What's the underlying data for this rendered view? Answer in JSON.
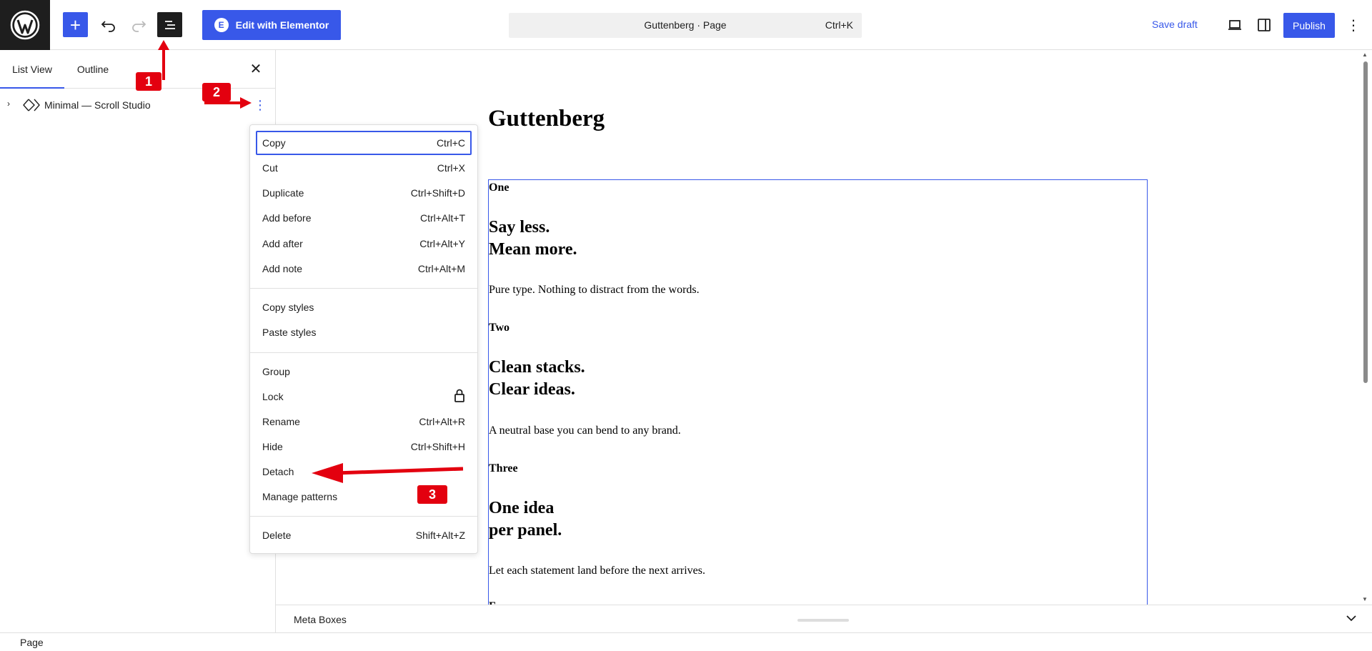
{
  "topbar": {
    "elementor_label": "Edit with Elementor",
    "elementor_icon_glyph": "E",
    "command_title": "Guttenberg · Page",
    "command_shortcut": "Ctrl+K",
    "save_draft_label": "Save draft",
    "publish_label": "Publish",
    "add_glyph": "+",
    "options_glyph": "⋮"
  },
  "sidebar": {
    "tabs": [
      {
        "label": "List View",
        "active": true
      },
      {
        "label": "Outline",
        "active": false
      }
    ],
    "close_glyph": "✕",
    "tree": [
      {
        "label": "Minimal — Scroll Studio",
        "chevron": "›",
        "menu_glyph": "⋮"
      }
    ]
  },
  "canvas": {
    "title": "Guttenberg",
    "sections": [
      {
        "label": "One",
        "headline_1": "Say less.",
        "headline_2": "Mean more.",
        "body": "Pure type. Nothing to distract from the words."
      },
      {
        "label": "Two",
        "headline_1": "Clean stacks.",
        "headline_2": "Clear ideas.",
        "body": "A neutral base you can bend to any brand."
      },
      {
        "label": "Three",
        "headline_1": "One idea",
        "headline_2": "per panel.",
        "body": "Let each statement land before the next arrives."
      },
      {
        "label": "F"
      }
    ]
  },
  "dropdown": {
    "groups": [
      [
        {
          "label": "Copy",
          "shortcut": "Ctrl+C",
          "focused": true
        },
        {
          "label": "Cut",
          "shortcut": "Ctrl+X"
        },
        {
          "label": "Duplicate",
          "shortcut": "Ctrl+Shift+D"
        },
        {
          "label": "Add before",
          "shortcut": "Ctrl+Alt+T"
        },
        {
          "label": "Add after",
          "shortcut": "Ctrl+Alt+Y"
        },
        {
          "label": "Add note",
          "shortcut": "Ctrl+Alt+M"
        }
      ],
      [
        {
          "label": "Copy styles",
          "shortcut": ""
        },
        {
          "label": "Paste styles",
          "shortcut": ""
        }
      ],
      [
        {
          "label": "Group",
          "shortcut": ""
        },
        {
          "label": "Lock",
          "shortcut": "",
          "icon": "lock-icon"
        },
        {
          "label": "Rename",
          "shortcut": "Ctrl+Alt+R"
        },
        {
          "label": "Hide",
          "shortcut": "Ctrl+Shift+H"
        },
        {
          "label": "Detach",
          "shortcut": ""
        },
        {
          "label": "Manage patterns",
          "shortcut": ""
        }
      ],
      [
        {
          "label": "Delete",
          "shortcut": "Shift+Alt+Z"
        }
      ]
    ]
  },
  "metabox": {
    "label": "Meta Boxes"
  },
  "footer": {
    "label": "Page"
  },
  "annotations": {
    "badges": [
      "1",
      "2",
      "3"
    ],
    "color": "#e3000f"
  },
  "colors": {
    "accent": "#3858e9",
    "dark": "#1e1e1e",
    "annotation": "#e3000f"
  }
}
